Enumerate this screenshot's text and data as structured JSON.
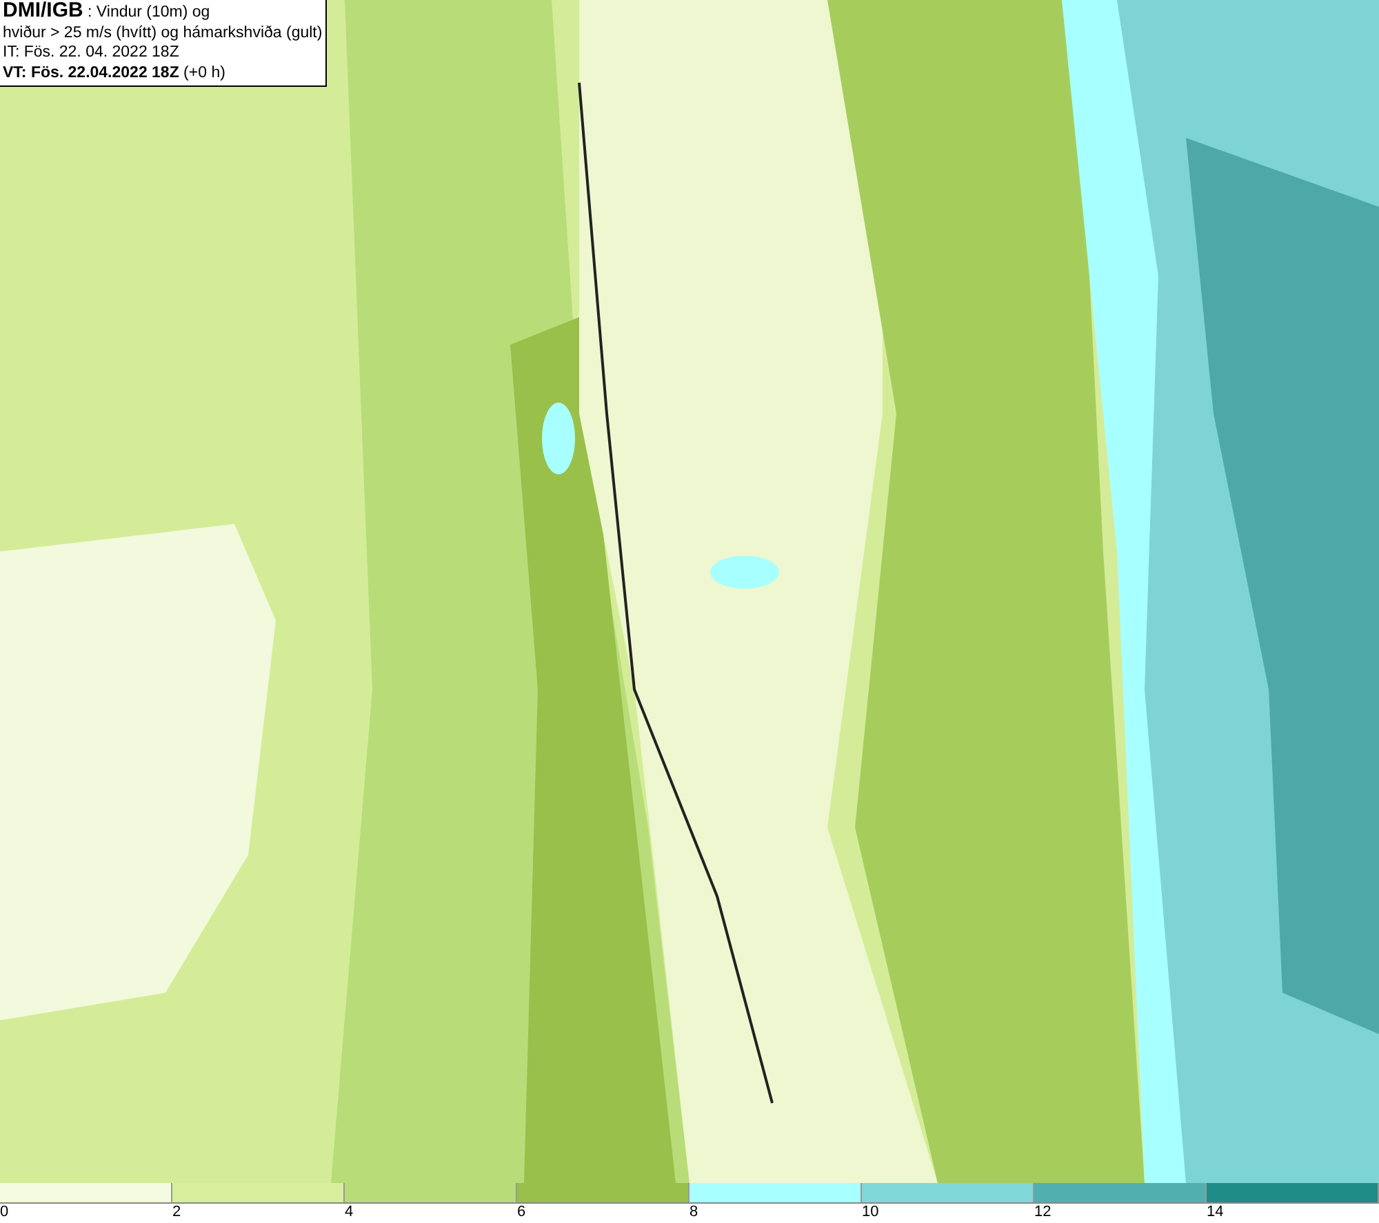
{
  "header": {
    "source": "DMI/IGB",
    "title_rest": " : Vindur (10m) og",
    "subtitle": "hviður > 25 m/s (hvítt) og hámarkshviða (gult)",
    "initial_time": "IT: Fös. 22. 04. 2022 18Z",
    "valid_time_bold": "VT: Fös. 22.04.2022 18Z",
    "valid_time_offset": " (+0 h)"
  },
  "legend": {
    "segments": [
      {
        "color": "#f5fbe0"
      },
      {
        "color": "#d8ee9c"
      },
      {
        "color": "#b8dc78"
      },
      {
        "color": "#98c04a"
      },
      {
        "color": "#a8ffff"
      },
      {
        "color": "#80d8d8"
      },
      {
        "color": "#50b0b0"
      },
      {
        "color": "#208c88"
      }
    ],
    "ticks": [
      "0",
      "2",
      "4",
      "6",
      "8",
      "10",
      "12",
      "14"
    ]
  }
}
